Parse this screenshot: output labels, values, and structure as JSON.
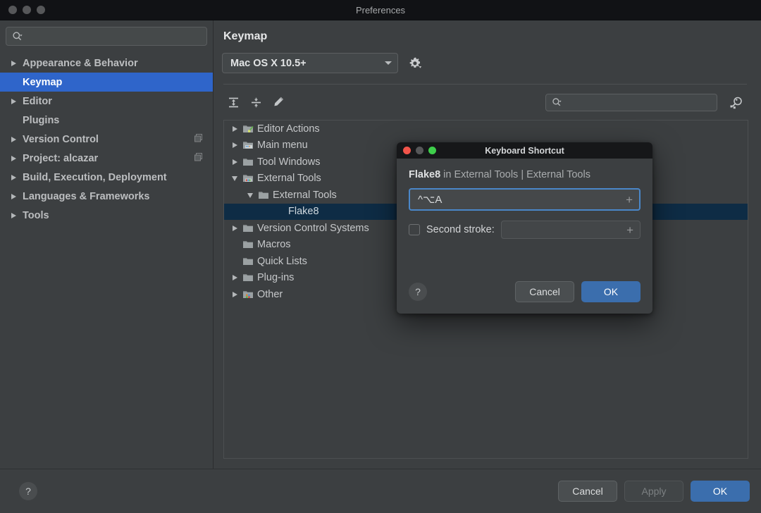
{
  "window": {
    "title": "Preferences",
    "traffic_lights": [
      "close",
      "minimize",
      "zoom"
    ]
  },
  "sidebar": {
    "search": {
      "value": "",
      "placeholder": "",
      "icon": "search-icon"
    },
    "items": [
      {
        "label": "Appearance & Behavior",
        "arrow": "collapsed",
        "selected": false,
        "badge": false
      },
      {
        "label": "Keymap",
        "arrow": "none",
        "selected": true,
        "badge": false
      },
      {
        "label": "Editor",
        "arrow": "collapsed",
        "selected": false,
        "badge": false
      },
      {
        "label": "Plugins",
        "arrow": "none",
        "selected": false,
        "badge": false
      },
      {
        "label": "Version Control",
        "arrow": "collapsed",
        "selected": false,
        "badge": true
      },
      {
        "label": "Project: alcazar",
        "arrow": "collapsed",
        "selected": false,
        "badge": true
      },
      {
        "label": "Build, Execution, Deployment",
        "arrow": "collapsed",
        "selected": false,
        "badge": false
      },
      {
        "label": "Languages & Frameworks",
        "arrow": "collapsed",
        "selected": false,
        "badge": false
      },
      {
        "label": "Tools",
        "arrow": "collapsed",
        "selected": false,
        "badge": false
      }
    ]
  },
  "main": {
    "title": "Keymap",
    "keymap_select": {
      "value": "Mac OS X 10.5+",
      "icon": "chevron-down-icon"
    },
    "gear_button": {
      "icon": "gear-icon"
    },
    "toolbar": [
      {
        "name": "expand-all-button",
        "icon": "expand-all-icon"
      },
      {
        "name": "collapse-all-button",
        "icon": "collapse-all-icon"
      },
      {
        "name": "edit-shortcut-button",
        "icon": "pencil-icon"
      }
    ],
    "tree_search": {
      "value": "",
      "placeholder": "",
      "icon": "search-icon"
    },
    "find_by_shortcut": {
      "icon": "find-by-shortcut-icon"
    },
    "tree": [
      {
        "label": "Editor Actions",
        "depth": 0,
        "arrow": "collapsed",
        "icon": "folder-editor-icon",
        "selected": false
      },
      {
        "label": "Main menu",
        "depth": 0,
        "arrow": "collapsed",
        "icon": "folder-menu-icon",
        "selected": false
      },
      {
        "label": "Tool Windows",
        "depth": 0,
        "arrow": "collapsed",
        "icon": "folder-icon",
        "selected": false
      },
      {
        "label": "External Tools",
        "depth": 0,
        "arrow": "expanded",
        "icon": "folder-tools-icon",
        "selected": false
      },
      {
        "label": "External Tools",
        "depth": 1,
        "arrow": "expanded",
        "icon": "folder-icon",
        "selected": false
      },
      {
        "label": "Flake8",
        "depth": 2,
        "arrow": "none",
        "icon": "none",
        "selected": true
      },
      {
        "label": "Version Control Systems",
        "depth": 0,
        "arrow": "collapsed",
        "icon": "folder-icon",
        "selected": false
      },
      {
        "label": "Macros",
        "depth": 0,
        "arrow": "none",
        "icon": "folder-icon",
        "selected": false
      },
      {
        "label": "Quick Lists",
        "depth": 0,
        "arrow": "none",
        "icon": "folder-icon",
        "selected": false
      },
      {
        "label": "Plug-ins",
        "depth": 0,
        "arrow": "collapsed",
        "icon": "folder-icon",
        "selected": false
      },
      {
        "label": "Other",
        "depth": 0,
        "arrow": "collapsed",
        "icon": "folder-other-icon",
        "selected": false
      }
    ]
  },
  "bottom_bar": {
    "help_label": "?",
    "cancel_label": "Cancel",
    "apply_label": "Apply",
    "apply_enabled": false,
    "ok_label": "OK"
  },
  "dialog": {
    "title": "Keyboard Shortcut",
    "subject_name": "Flake8",
    "subject_rest": " in External Tools | External Tools",
    "shortcut_value": "^⌥A",
    "shortcut_add_glyph": "+",
    "second_stroke": {
      "label": "Second stroke:",
      "checked": false,
      "value": "",
      "add_glyph": "+"
    },
    "help_label": "?",
    "cancel_label": "Cancel",
    "ok_label": "OK"
  },
  "colors": {
    "window_bg": "#3c3f41",
    "titlebar_bg": "#111215",
    "sidebar_selected": "#2f65ca",
    "tree_selected": "#0e2c45",
    "primary_button": "#3b6ead",
    "focus_ring": "#4a87c9"
  }
}
